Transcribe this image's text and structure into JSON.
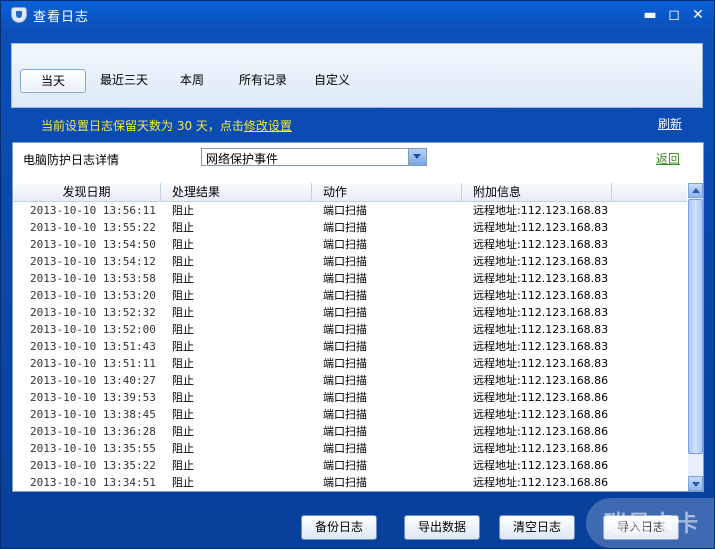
{
  "window": {
    "title": "查看日志",
    "controls": {
      "minimize": "▬",
      "maximize": "◻",
      "close": "✕"
    }
  },
  "tabs": [
    "当天",
    "最近三天",
    "本周",
    "所有记录",
    "自定义"
  ],
  "active_tab": "当天",
  "retention": {
    "text": "当前设置日志保留天数为 30 天，点击",
    "link": "修改设置"
  },
  "refresh": "刷新",
  "detail": {
    "label": "电脑防护日志详情",
    "select_value": "网络保护事件",
    "back": "返回"
  },
  "table": {
    "headers": [
      "发现日期",
      "处理结果",
      "动作",
      "附加信息"
    ],
    "rows": [
      [
        "2013-10-10 13:56:11",
        "阻止",
        "端口扫描",
        "远程地址:112.123.168.83"
      ],
      [
        "2013-10-10 13:55:22",
        "阻止",
        "端口扫描",
        "远程地址:112.123.168.83"
      ],
      [
        "2013-10-10 13:54:50",
        "阻止",
        "端口扫描",
        "远程地址:112.123.168.83"
      ],
      [
        "2013-10-10 13:54:12",
        "阻止",
        "端口扫描",
        "远程地址:112.123.168.83"
      ],
      [
        "2013-10-10 13:53:58",
        "阻止",
        "端口扫描",
        "远程地址:112.123.168.83"
      ],
      [
        "2013-10-10 13:53:20",
        "阻止",
        "端口扫描",
        "远程地址:112.123.168.83"
      ],
      [
        "2013-10-10 13:52:32",
        "阻止",
        "端口扫描",
        "远程地址:112.123.168.83"
      ],
      [
        "2013-10-10 13:52:00",
        "阻止",
        "端口扫描",
        "远程地址:112.123.168.83"
      ],
      [
        "2013-10-10 13:51:43",
        "阻止",
        "端口扫描",
        "远程地址:112.123.168.83"
      ],
      [
        "2013-10-10 13:51:11",
        "阻止",
        "端口扫描",
        "远程地址:112.123.168.83"
      ],
      [
        "2013-10-10 13:40:27",
        "阻止",
        "端口扫描",
        "远程地址:112.123.168.86"
      ],
      [
        "2013-10-10 13:39:53",
        "阻止",
        "端口扫描",
        "远程地址:112.123.168.86"
      ],
      [
        "2013-10-10 13:38:45",
        "阻止",
        "端口扫描",
        "远程地址:112.123.168.86"
      ],
      [
        "2013-10-10 13:36:28",
        "阻止",
        "端口扫描",
        "远程地址:112.123.168.86"
      ],
      [
        "2013-10-10 13:35:55",
        "阻止",
        "端口扫描",
        "远程地址:112.123.168.86"
      ],
      [
        "2013-10-10 13:35:22",
        "阻止",
        "端口扫描",
        "远程地址:112.123.168.86"
      ],
      [
        "2013-10-10 13:34:51",
        "阻止",
        "端口扫描",
        "远程地址:112.123.168.86"
      ]
    ]
  },
  "buttons": {
    "backup": "备份日志",
    "export": "导出数据",
    "clear": "清空日志",
    "import": "导入日志"
  },
  "watermark": "瑞星卡卡"
}
